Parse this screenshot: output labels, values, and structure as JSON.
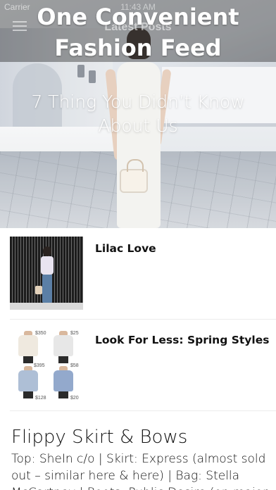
{
  "status_bar": {
    "carrier": "Carrier",
    "time": "11:43 AM"
  },
  "nav": {
    "title": "Latest Posts",
    "menu_icon": "hamburger-menu-icon"
  },
  "banner": {
    "line1": "One Convenient",
    "line2": "Fashion Feed"
  },
  "hero": {
    "title_line1": "7 Thing You Didn’t Know",
    "title_line2": "About Us"
  },
  "posts": [
    {
      "title": "Lilac Love"
    },
    {
      "title": "Look For Less: Spring Styles"
    }
  ],
  "thumb_prices": [
    "$350",
    "$25",
    "$395",
    "$58",
    "$128",
    "$20"
  ],
  "article": {
    "title": "Flippy Skirt & Bows",
    "body": "Top: SheIn c/o | Skirt: Express (almost sold out – similar here & here) | Bag: Stella McCartney | Boots: Public Desire (on major"
  },
  "colors": {
    "overlay": "rgba(0,0,0,0.35)",
    "text": "#111111",
    "divider": "#ececec"
  }
}
